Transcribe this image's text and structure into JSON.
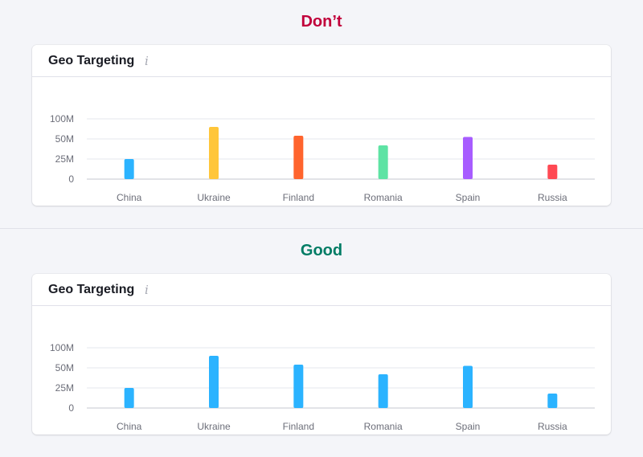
{
  "sections": [
    {
      "verdict": "Don’t",
      "verdict_color": "#c1003b",
      "card_title": "Geo Targeting",
      "info_icon": "info-icon",
      "bar_colors": [
        "#2bb3ff",
        "#ffc63a",
        "#ff642d",
        "#5ee3a4",
        "#a75cff",
        "#ff4953"
      ]
    },
    {
      "verdict": "Good",
      "verdict_color": "#007c65",
      "card_title": "Geo Targeting",
      "info_icon": "info-icon",
      "bar_colors": [
        "#2bb3ff",
        "#2bb3ff",
        "#2bb3ff",
        "#2bb3ff",
        "#2bb3ff",
        "#2bb3ff"
      ]
    }
  ],
  "chart_data": [
    {
      "type": "bar",
      "categories": [
        "China",
        "Ukraine",
        "Finland",
        "Romania",
        "Spain",
        "Russia"
      ],
      "values": [
        25,
        80,
        58,
        42,
        55,
        18
      ],
      "ticks": [
        {
          "value": 0,
          "label": "0"
        },
        {
          "value": 25,
          "label": "25M"
        },
        {
          "value": 50,
          "label": "50M"
        },
        {
          "value": 100,
          "label": "100M"
        }
      ],
      "tick_axis_note": "",
      "grid": true
    },
    {
      "type": "bar",
      "categories": [
        "China",
        "Ukraine",
        "Finland",
        "Romania",
        "Spain",
        "Russia"
      ],
      "values": [
        25,
        80,
        58,
        42,
        55,
        18
      ],
      "ticks": [
        {
          "value": 0,
          "label": "0"
        },
        {
          "value": 25,
          "label": "25M"
        },
        {
          "value": 50,
          "label": "50M"
        },
        {
          "value": 100,
          "label": "100M"
        }
      ],
      "grid": true
    }
  ]
}
